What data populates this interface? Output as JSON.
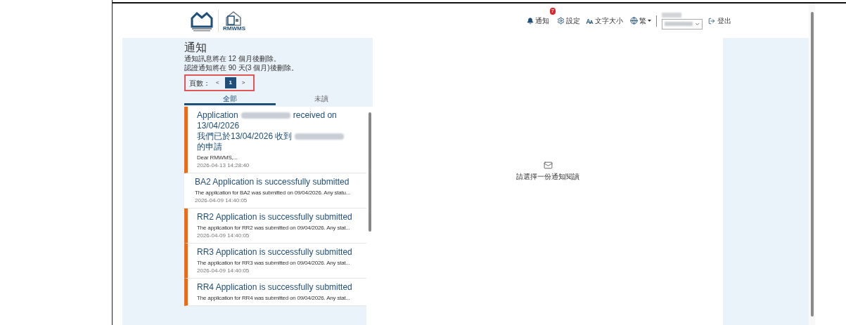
{
  "header": {
    "notifications": {
      "label": "通知",
      "badge": "7"
    },
    "settings": {
      "label": "設定"
    },
    "font_size": {
      "label": "文字大小"
    },
    "language": {
      "label": "繁"
    },
    "logout": {
      "label": "登出"
    },
    "logo_text": "RMWMS"
  },
  "panel": {
    "title": "通知",
    "notes": [
      "通知訊息將在 12 個月後刪除。",
      "認證通知將在 90 天(3 個月)後刪除。"
    ],
    "pagination": {
      "label": "頁數：",
      "prev": "<",
      "pages": [
        {
          "label": "1",
          "selected": true
        }
      ],
      "next": ">"
    },
    "tabs": [
      {
        "label": "全部",
        "selected": true
      },
      {
        "label": "未讀",
        "selected": false
      }
    ],
    "items": [
      {
        "unread": true,
        "title_parts": [
          "Application",
          "received on 13/04/2026"
        ],
        "title_zh_parts": [
          "我們已於13/04/2026 收到",
          "的申請"
        ],
        "snippet": "Dear RMWMS,...",
        "time": "2026-04-13 14:28:40"
      },
      {
        "unread": false,
        "title_parts": [
          "BA2 Application is successfully submitted"
        ],
        "snippet": "The application for BA2 was submitted on 09/04/2026. Any statu...",
        "time": "2026-04-09 14:40:05"
      },
      {
        "unread": true,
        "title_parts": [
          "RR2 Application is successfully submitted"
        ],
        "snippet": "The application for RR2 was submitted on 09/04/2026. Any stat...",
        "time": "2026-04-09 14:40:05"
      },
      {
        "unread": true,
        "title_parts": [
          "RR3 Application is successfully submitted"
        ],
        "snippet": "The application for RR3 was submitted on 09/04/2026. Any stat...",
        "time": "2026-04-09 14:40:05"
      },
      {
        "unread": true,
        "title_parts": [
          "RR4 Application is successfully submitted"
        ],
        "snippet": "The application for RR4 was submitted on 09/04/2026. Any stat..."
      }
    ]
  },
  "detail": {
    "empty_message": "請選擇一份通知閱讀"
  }
}
